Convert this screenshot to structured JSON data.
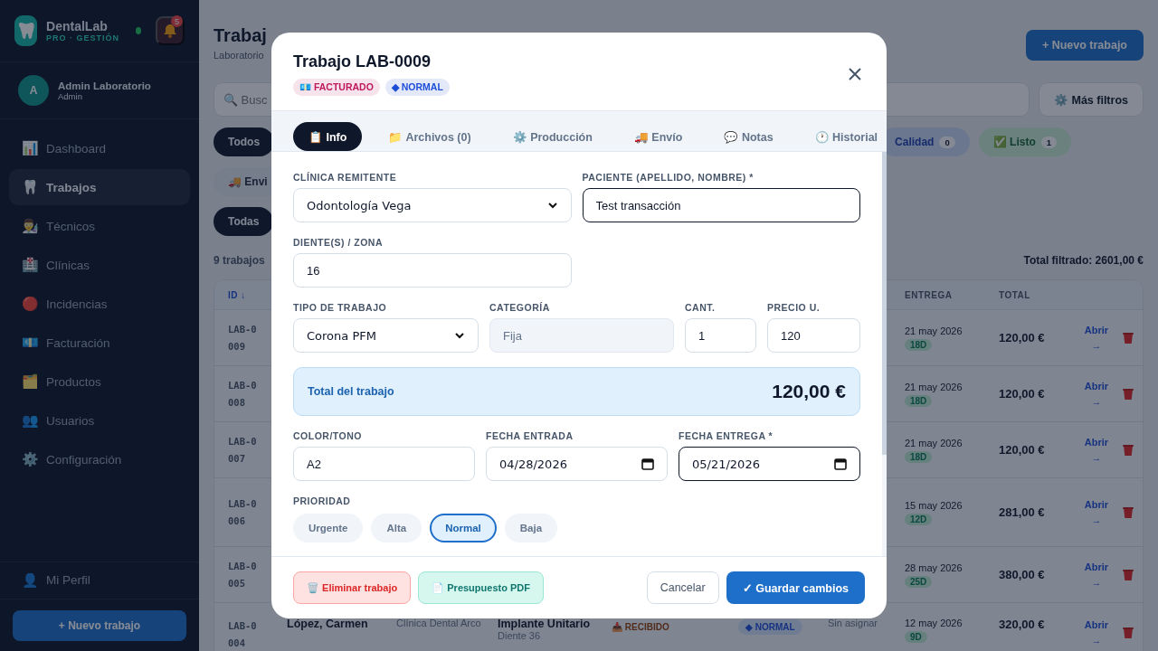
{
  "sidebar": {
    "brand": {
      "name": "DentalLab",
      "tagline": "PRO · GESTIÓN",
      "online": true
    },
    "notifications": {
      "count": "5"
    },
    "user": {
      "initial": "A",
      "name": "Admin Laboratorio",
      "role": "Admin"
    },
    "items": [
      {
        "icon": "📊",
        "label": "Dashboard",
        "selected": false
      },
      {
        "icon": "🦷",
        "label": "Trabajos",
        "selected": true
      },
      {
        "icon": "👨‍🔬",
        "label": "Técnicos",
        "selected": false
      },
      {
        "icon": "🏥",
        "label": "Clínicas",
        "selected": false
      },
      {
        "icon": "🔴",
        "label": "Incidencias",
        "selected": false
      },
      {
        "icon": "💶",
        "label": "Facturación",
        "selected": false
      },
      {
        "icon": "🗂️",
        "label": "Productos",
        "selected": false
      },
      {
        "icon": "👥",
        "label": "Usuarios",
        "selected": false
      },
      {
        "icon": "⚙️",
        "label": "Configuración",
        "selected": false
      }
    ],
    "profile": {
      "icon": "👤",
      "label": "Mi Perfil"
    },
    "new_button": "+ Nuevo trabajo"
  },
  "page": {
    "title": "Trabaj",
    "subtitle": "Laboratorio",
    "new_button": "+ Nuevo trabajo",
    "search": {
      "placeholder": "🔍 Busc"
    },
    "more_filters": "⚙️ Más filtros",
    "chip_rows": [
      [
        {
          "label": "Todos",
          "selected": true
        },
        {
          "label": "Calidad",
          "count": "0",
          "selected": false,
          "kind": "info"
        },
        {
          "label": "✅ Listo",
          "count": "1",
          "selected": false,
          "kind": "success"
        }
      ],
      [
        {
          "label": "🚚 Envi",
          "selected": false
        }
      ],
      [
        {
          "label": "Todas",
          "selected": true
        }
      ]
    ],
    "count_text": "9 trabajos",
    "total_text": "Total filtrado: 2601,00 €",
    "table": {
      "columns": [
        "ID ↓",
        "ENTREGA",
        "TOTAL"
      ],
      "rows": [
        {
          "id": "LAB-0009",
          "due": "21 may 2026",
          "days": "18D",
          "total": "120,00 €",
          "action": "Abrir →"
        },
        {
          "id": "LAB-0008",
          "due": "21 may 2026",
          "days": "18D",
          "total": "120,00 €",
          "action": "Abrir →"
        },
        {
          "id": "LAB-0007",
          "due": "21 may 2026",
          "days": "18D",
          "total": "120,00 €",
          "action": "Abrir →"
        },
        {
          "id": "LAB-0006",
          "due": "15 may 2026",
          "days": "12D",
          "total": "281,00 €",
          "action": "Abrir →"
        },
        {
          "id": "LAB-0005",
          "due": "28 may 2026",
          "days": "25D",
          "total": "380,00 €",
          "action": "Abrir →"
        },
        {
          "id": "LAB-0004",
          "patient": "López, Carmen",
          "clinic": "Clínica Dental Arco",
          "work": "Implante Unitario",
          "work_detail": "Diente 36",
          "status": "📥 RECIBIDO",
          "priority": "◆ NORMAL",
          "technician": "Sin asignar",
          "due": "12 may 2026",
          "days": "9D",
          "total": "320,00 €",
          "action": "Abrir →"
        }
      ]
    }
  },
  "modal": {
    "title": "Trabajo LAB-0009",
    "badges": [
      {
        "label": "💶 FACTURADO",
        "color": "#be185d"
      },
      {
        "label": "◆ NORMAL",
        "color": "#1d4ed8"
      }
    ],
    "tabs": [
      {
        "label": "📋 Info",
        "selected": true
      },
      {
        "label": "📁 Archivos (0)",
        "selected": false
      },
      {
        "label": "⚙️ Producción",
        "selected": false
      },
      {
        "label": "🚚 Envío",
        "selected": false
      },
      {
        "label": "💬 Notas",
        "selected": false
      },
      {
        "label": "🕐 Historial",
        "selected": false
      }
    ],
    "form_top": [
      [
        {
          "kind": "select",
          "label": "CLÍNICA REMITENTE",
          "value": "Odontología Vega",
          "focused": false
        },
        {
          "kind": "text",
          "label": "PACIENTE (APELLIDO, NOMBRE) *",
          "value": "Test transacción",
          "focused": true
        }
      ],
      [
        {
          "kind": "text",
          "label": "DIENTE(S) / ZONA",
          "value": "16",
          "focused": false
        }
      ],
      [
        {
          "kind": "select",
          "label": "TIPO DE TRABAJO",
          "value": "Corona PFM",
          "focused": false
        },
        {
          "kind": "readonly",
          "label": "CATEGORÍA",
          "value": "Fija",
          "focused": false
        },
        {
          "kind": "text",
          "label": "CANT.",
          "value": "1",
          "focused": false
        },
        {
          "kind": "text",
          "label": "PRECIO U.",
          "value": "120",
          "focused": false
        }
      ]
    ],
    "total": {
      "label": "Total del trabajo",
      "value": "120,00 €"
    },
    "form_bottom": [
      [
        {
          "kind": "text",
          "label": "COLOR/TONO",
          "value": "A2",
          "focused": false
        },
        {
          "kind": "date",
          "label": "FECHA ENTRADA",
          "value": "04/28/2026",
          "focused": false
        },
        {
          "kind": "date",
          "label": "FECHA ENTREGA *",
          "value": "05/21/2026",
          "focused": true
        }
      ]
    ],
    "priority": {
      "label": "PRIORIDAD",
      "options": [
        {
          "label": "Urgente",
          "selected": false
        },
        {
          "label": "Alta",
          "selected": false
        },
        {
          "label": "Normal",
          "selected": true
        },
        {
          "label": "Baja",
          "selected": false
        }
      ]
    },
    "footer": {
      "delete": "🗑️ Eliminar trabajo",
      "pdf": "📄 Presupuesto PDF",
      "cancel": "Cancelar",
      "save": "✓ Guardar cambios"
    }
  }
}
